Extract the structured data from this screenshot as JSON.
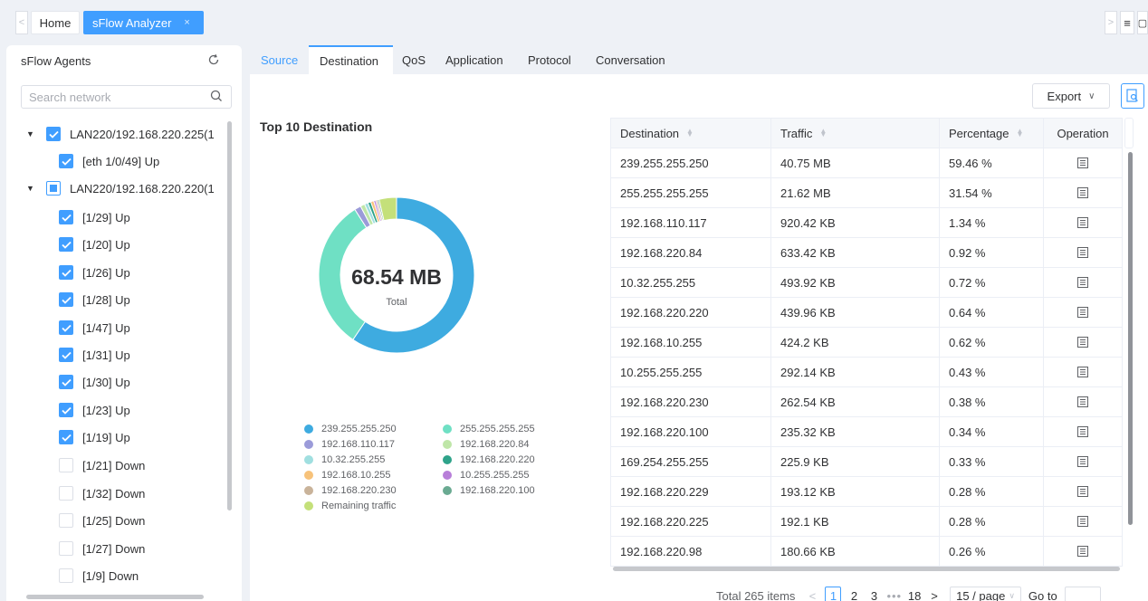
{
  "topbar": {
    "tabs": [
      {
        "label": "Home"
      },
      {
        "label": "sFlow Analyzer",
        "close": "×"
      }
    ],
    "left_arrow": "<",
    "right_arrow": ">",
    "menu_icon": "≡",
    "extra_icon": "▢"
  },
  "sidebar": {
    "title": "sFlow Agents",
    "refresh_icon": "refresh-icon",
    "search": {
      "placeholder": "Search network",
      "value": ""
    },
    "tree": [
      {
        "label": "LAN220/192.168.220.225(1",
        "level": 0,
        "state": "checked",
        "expanded": true
      },
      {
        "label": "[eth 1/0/49] Up",
        "level": 1,
        "state": "checked"
      },
      {
        "label": "LAN220/192.168.220.220(1",
        "level": 0,
        "state": "indeterminate",
        "expanded": true
      },
      {
        "label": "[1/29] Up",
        "level": 1,
        "state": "checked"
      },
      {
        "label": "[1/20] Up",
        "level": 1,
        "state": "checked"
      },
      {
        "label": "[1/26] Up",
        "level": 1,
        "state": "checked"
      },
      {
        "label": "[1/28] Up",
        "level": 1,
        "state": "checked"
      },
      {
        "label": "[1/47] Up",
        "level": 1,
        "state": "checked"
      },
      {
        "label": "[1/31] Up",
        "level": 1,
        "state": "checked"
      },
      {
        "label": "[1/30] Up",
        "level": 1,
        "state": "checked"
      },
      {
        "label": "[1/23] Up",
        "level": 1,
        "state": "checked"
      },
      {
        "label": "[1/19] Up",
        "level": 1,
        "state": "checked"
      },
      {
        "label": "[1/21] Down",
        "level": 1,
        "state": "unchecked"
      },
      {
        "label": "[1/32] Down",
        "level": 1,
        "state": "unchecked"
      },
      {
        "label": "[1/25] Down",
        "level": 1,
        "state": "unchecked"
      },
      {
        "label": "[1/27] Down",
        "level": 1,
        "state": "unchecked"
      },
      {
        "label": "[1/9] Down",
        "level": 1,
        "state": "unchecked"
      }
    ]
  },
  "main": {
    "tabs": [
      {
        "label": "Source"
      },
      {
        "label": "Destination",
        "active": true
      },
      {
        "label": "QoS"
      },
      {
        "label": "Application"
      },
      {
        "label": "Protocol"
      },
      {
        "label": "Conversation"
      }
    ],
    "export_label": "Export",
    "chart_title": "Top 10 Destination",
    "donut_total": "68.54 MB",
    "donut_total_label": "Total"
  },
  "chart_data": {
    "type": "pie",
    "title": "Top 10 Destination",
    "center_text": "68.54 MB",
    "center_subtext": "Total",
    "legend_placement": "bottom",
    "categories": [
      "239.255.255.250",
      "255.255.255.255",
      "192.168.110.117",
      "192.168.220.84",
      "10.32.255.255",
      "192.168.220.220",
      "192.168.10.255",
      "10.255.255.255",
      "192.168.220.230",
      "192.168.220.100",
      "Remaining traffic"
    ],
    "values": [
      59.46,
      31.54,
      1.34,
      0.92,
      0.72,
      0.64,
      0.62,
      0.43,
      0.38,
      0.34,
      3.61
    ],
    "colors": [
      "#3eabe0",
      "#6fe0c4",
      "#9b9bd9",
      "#bfe6a8",
      "#a0dfe0",
      "#2fa38a",
      "#f7c27a",
      "#b87fd9",
      "#c9b39a",
      "#6aaa92",
      "#c4e07a"
    ]
  },
  "table": {
    "columns": [
      {
        "label": "Destination",
        "sortable": true
      },
      {
        "label": "Traffic",
        "sortable": true
      },
      {
        "label": "Percentage",
        "sortable": true
      },
      {
        "label": "Operation",
        "sortable": false
      }
    ],
    "rows": [
      [
        "239.255.255.250",
        "40.75 MB",
        "59.46 %"
      ],
      [
        "255.255.255.255",
        "21.62 MB",
        "31.54 %"
      ],
      [
        "192.168.110.117",
        "920.42 KB",
        "1.34 %"
      ],
      [
        "192.168.220.84",
        "633.42 KB",
        "0.92 %"
      ],
      [
        "10.32.255.255",
        "493.92 KB",
        "0.72 %"
      ],
      [
        "192.168.220.220",
        "439.96 KB",
        "0.64 %"
      ],
      [
        "192.168.10.255",
        "424.2 KB",
        "0.62 %"
      ],
      [
        "10.255.255.255",
        "292.14 KB",
        "0.43 %"
      ],
      [
        "192.168.220.230",
        "262.54 KB",
        "0.38 %"
      ],
      [
        "192.168.220.100",
        "235.32 KB",
        "0.34 %"
      ],
      [
        "169.254.255.255",
        "225.9 KB",
        "0.33 %"
      ],
      [
        "192.168.220.229",
        "193.12 KB",
        "0.28 %"
      ],
      [
        "192.168.220.225",
        "192.1 KB",
        "0.28 %"
      ],
      [
        "192.168.220.98",
        "180.66 KB",
        "0.26 %"
      ]
    ],
    "operation_icon": "detail-icon"
  },
  "pagination": {
    "total": "Total 265 items",
    "prev": "<",
    "pages": [
      "1",
      "2",
      "3"
    ],
    "dots": "•••",
    "last": "18",
    "next": ">",
    "current": "1",
    "page_size": "15 / page",
    "goto_label": "Go to",
    "goto_value": ""
  }
}
